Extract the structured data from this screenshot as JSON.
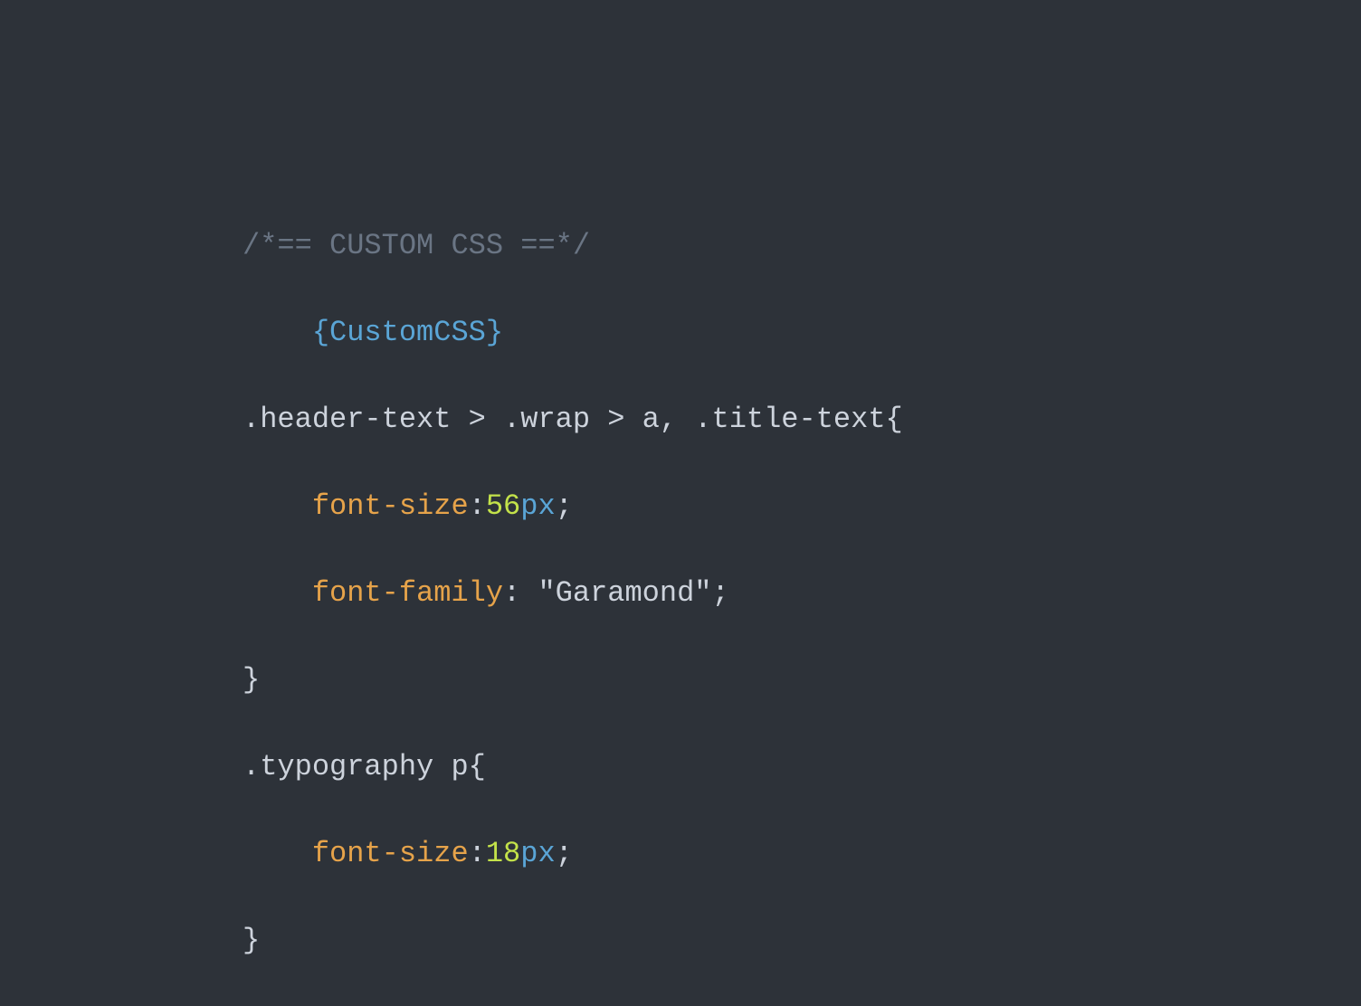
{
  "code": {
    "comment": "/*== CUSTOM CSS ==*/",
    "placeholder": "{CustomCSS}",
    "rules": [
      {
        "selector": ".header-text > .wrap > a, .title-text",
        "open": "{",
        "declarations": [
          {
            "prop": "font-size",
            "colon": ":",
            "numval": "56",
            "unit": "px",
            "semi": ";"
          },
          {
            "prop": "font-family",
            "colon": ": ",
            "strval": "\"Garamond\"",
            "semi": ";"
          }
        ],
        "close": "}"
      },
      {
        "selector": ".typography p",
        "open": "{",
        "declarations": [
          {
            "prop": "font-size",
            "colon": ":",
            "numval": "18",
            "unit": "px",
            "semi": ";"
          }
        ],
        "close": "}"
      }
    ]
  }
}
